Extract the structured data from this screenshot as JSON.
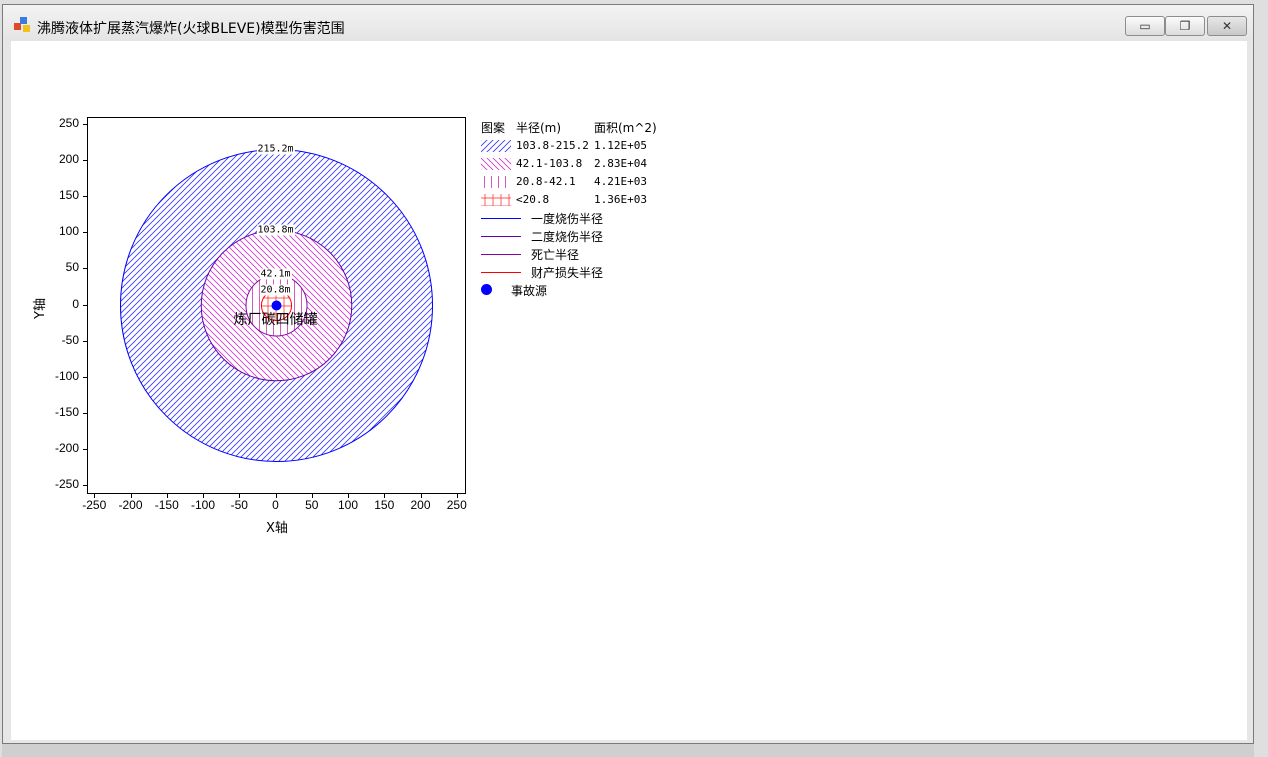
{
  "window": {
    "title": "沸腾液体扩展蒸汽爆炸(火球BLEVE)模型伤害范围",
    "buttons": {
      "minimize": "▭",
      "maximize": "❐",
      "close": "✕"
    }
  },
  "chart_data": {
    "type": "scatter",
    "xlabel": "X轴",
    "ylabel": "Y轴",
    "xlim": [
      -260,
      260
    ],
    "ylim": [
      -260,
      260
    ],
    "x_ticks": [
      -250,
      -200,
      -150,
      -100,
      -50,
      0,
      50,
      100,
      150,
      200,
      250
    ],
    "y_ticks": [
      250,
      200,
      150,
      100,
      50,
      0,
      -50,
      -100,
      -150,
      -200,
      -250
    ],
    "x_tick_labels": [
      "-250",
      "-200",
      "-150",
      "-100",
      "-50",
      "0",
      "50",
      "100",
      "150",
      "200",
      "250"
    ],
    "y_tick_labels": [
      "250",
      "200",
      "150",
      "100",
      "50",
      "0",
      "-50",
      "-100",
      "-150",
      "-200",
      "-250"
    ],
    "rings": [
      {
        "radius": 215.2,
        "label": "215.2m",
        "stroke": "#0000ff",
        "hatch": "#3333ff"
      },
      {
        "radius": 103.8,
        "label": "103.8m",
        "stroke": "#6600aa",
        "hatch": "#cc33cc"
      },
      {
        "radius": 42.1,
        "label": "42.1m",
        "stroke": "#8800aa",
        "hatch": "#cc33aa"
      },
      {
        "radius": 20.8,
        "label": "20.8m",
        "stroke": "#ff0000",
        "hatch": "#ff3333"
      }
    ],
    "source": {
      "x": 0,
      "y": 0,
      "color": "#0000ff",
      "name": "炼厂碳四储罐"
    },
    "grid": false
  },
  "legend": {
    "headers": {
      "pattern": "图案",
      "radius": "半径(m)",
      "area": "面积(m^2)"
    },
    "rows": [
      {
        "range": "103.8-215.2",
        "area": "1.12E+05"
      },
      {
        "range": "42.1-103.8",
        "area": "2.83E+04"
      },
      {
        "range": "20.8-42.1",
        "area": "4.21E+03"
      },
      {
        "range": "<20.8",
        "area": "1.36E+03"
      }
    ],
    "lines": [
      {
        "label": "一度烧伤半径",
        "color": "#0000ff"
      },
      {
        "label": "二度烧伤半径",
        "color": "#6600aa"
      },
      {
        "label": "死亡半径",
        "color": "#8800aa"
      },
      {
        "label": "财产损失半径",
        "color": "#ff0000"
      }
    ],
    "source_label": "事故源"
  }
}
